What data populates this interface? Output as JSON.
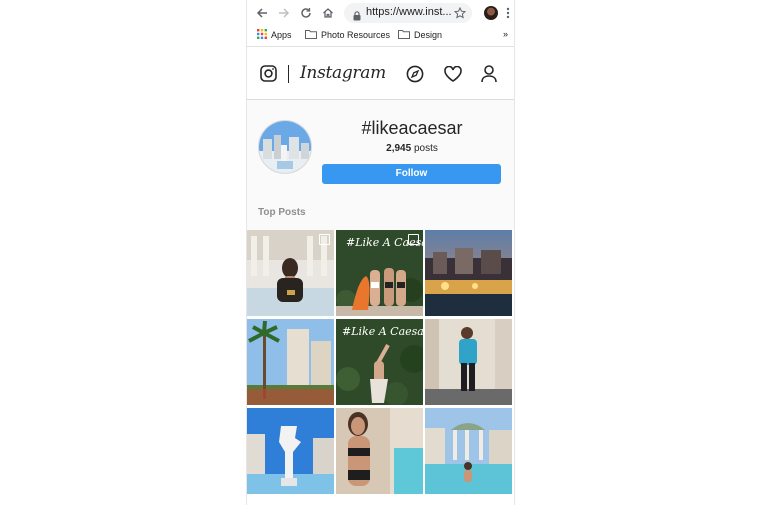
{
  "browser": {
    "url": "https://www.inst...",
    "bookmarks": [
      {
        "label": "Apps",
        "icon": "apps-grid-icon"
      },
      {
        "label": "Photo Resources",
        "icon": "folder-icon"
      },
      {
        "label": "Design",
        "icon": "folder-icon"
      }
    ],
    "more_label": "»"
  },
  "header": {
    "logo_text": "Instagram"
  },
  "profile": {
    "hashtag": "#likeacaesar",
    "post_count": "2,945",
    "posts_label": "posts",
    "follow_label": "Follow"
  },
  "section": {
    "top_posts_label": "Top Posts"
  },
  "grid": {
    "overlay_1": "#Like A Caesar",
    "overlay_2": "#Like A Caesar"
  },
  "colors": {
    "follow_blue": "#3897f0",
    "text_dark": "#262626",
    "muted": "#8e8e8e"
  }
}
